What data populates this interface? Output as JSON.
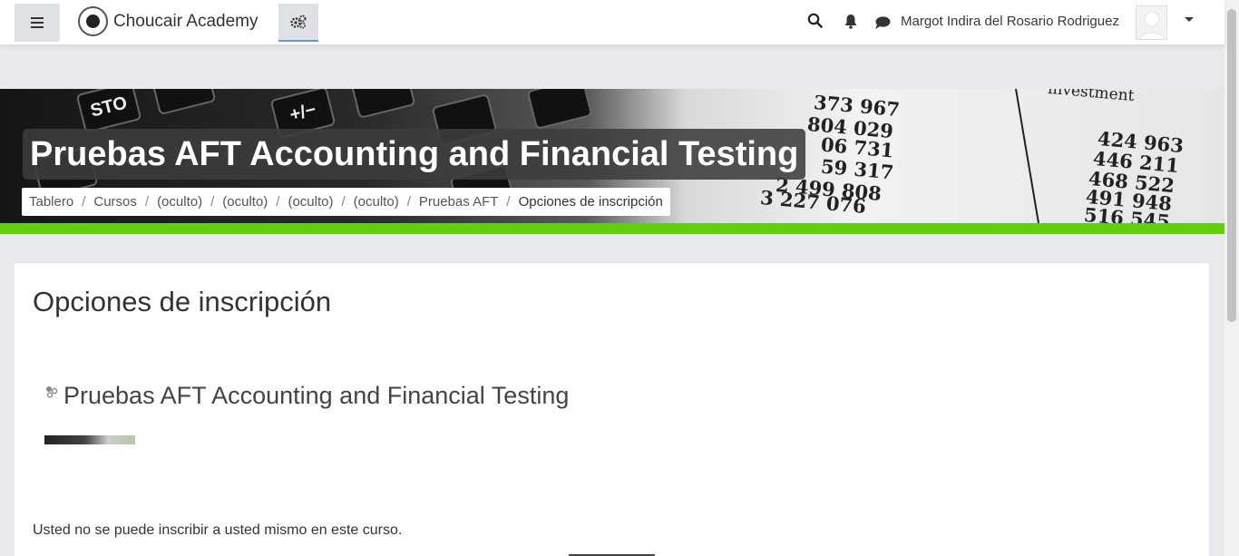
{
  "header": {
    "site_name": "Choucair Academy",
    "user_name": "Margot Indira del Rosario Rodriguez"
  },
  "icons": {
    "menu": "hamburger-icon",
    "site_logo": "logo-icon",
    "admin": "cogs-icon",
    "search": "search-icon",
    "notifications": "bell-icon",
    "messages": "comment-icon",
    "user_menu": "caret-down-icon",
    "course": "course-icon"
  },
  "banner": {
    "title": "Pruebas AFT Accounting and Financial Testing",
    "calculator_keys": [
      "STO",
      "+/−"
    ],
    "printed_numbers": [
      "373 967",
      "804 029",
      "06 731",
      "59 317",
      "2 499 808",
      "3 227 076",
      "424 963",
      "446 211",
      "468 522",
      "491 948",
      "516 545",
      "investment"
    ]
  },
  "breadcrumb": [
    {
      "label": "Tablero"
    },
    {
      "label": "Cursos"
    },
    {
      "label": "(oculto)"
    },
    {
      "label": "(oculto)"
    },
    {
      "label": "(oculto)"
    },
    {
      "label": "(oculto)"
    },
    {
      "label": "Pruebas AFT"
    },
    {
      "label": "Opciones de inscripción"
    }
  ],
  "main": {
    "page_title": "Opciones de inscripción",
    "course_name": "Pruebas AFT Accounting and Financial Testing",
    "notice": "Usted no se puede inscribir a usted mismo en este curso."
  },
  "colors": {
    "accent_bar": "#5fd10a",
    "page_bg": "#e7e9ec",
    "nav_button_bg": "#dee2e6"
  }
}
